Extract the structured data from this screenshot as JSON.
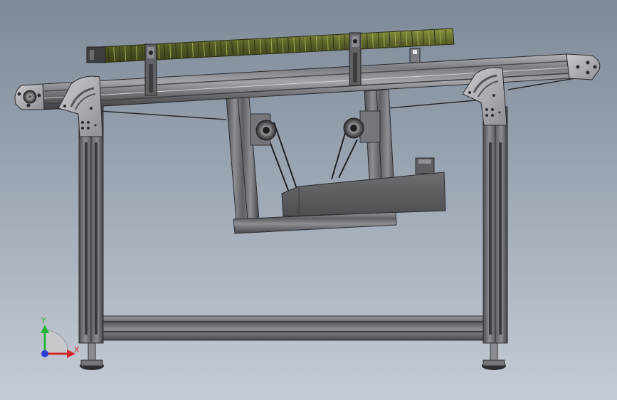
{
  "viewport": {
    "background_top": "#7f8a99",
    "background_bottom": "#c6ccd4"
  },
  "model": {
    "name": "conveyor-assembly",
    "frame_color": "#6e7075",
    "frame_light": "#a9abb0",
    "frame_dark": "#3c3d41",
    "belt_color": "#4a4c50",
    "drag_chain_color": "#6d7531",
    "motor_color": "#5b5d61"
  },
  "triad": {
    "y_label": "Y",
    "x_label": "X",
    "y_color": "#27b43a",
    "x_color": "#d22a2a",
    "z_color": "#2a3fd6"
  }
}
